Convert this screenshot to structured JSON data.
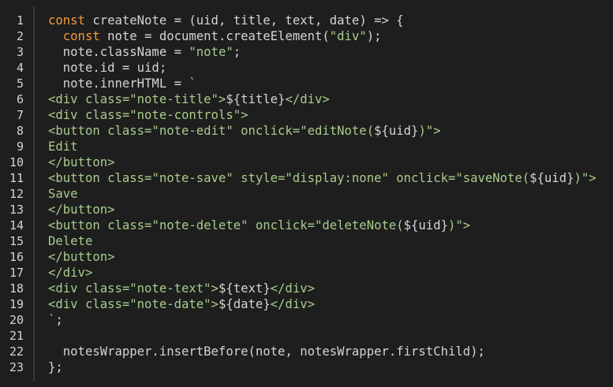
{
  "editor": {
    "colors": {
      "background": "#1e1e1e",
      "text": "#d4d4d4",
      "keyword": "#f29c3a",
      "string": "#a8cc8c",
      "divider": "#3a3a3a"
    },
    "lines": [
      {
        "n": "1",
        "tokens": [
          {
            "t": "key",
            "v": "const"
          },
          {
            "t": "txt",
            "v": " createNote = (uid, title, text, date) => {"
          }
        ]
      },
      {
        "n": "2",
        "tokens": [
          {
            "t": "txt",
            "v": "  "
          },
          {
            "t": "key",
            "v": "const"
          },
          {
            "t": "txt",
            "v": " note = document.createElement("
          },
          {
            "t": "str",
            "v": "\"div\""
          },
          {
            "t": "txt",
            "v": ");"
          }
        ]
      },
      {
        "n": "3",
        "tokens": [
          {
            "t": "txt",
            "v": "  note.className = "
          },
          {
            "t": "str",
            "v": "\"note\""
          },
          {
            "t": "txt",
            "v": ";"
          }
        ]
      },
      {
        "n": "4",
        "tokens": [
          {
            "t": "txt",
            "v": "  note.id = uid;"
          }
        ]
      },
      {
        "n": "5",
        "tokens": [
          {
            "t": "txt",
            "v": "  note.innerHTML = "
          },
          {
            "t": "str",
            "v": "`"
          }
        ]
      },
      {
        "n": "6",
        "tokens": [
          {
            "t": "str",
            "v": "<div class=\"note-title\">"
          },
          {
            "t": "txt",
            "v": "${title}"
          },
          {
            "t": "str",
            "v": "</div>"
          }
        ]
      },
      {
        "n": "7",
        "tokens": [
          {
            "t": "str",
            "v": "<div class=\"note-controls\">"
          }
        ]
      },
      {
        "n": "8",
        "tokens": [
          {
            "t": "str",
            "v": "<button class=\"note-edit\" onclick=\"editNote("
          },
          {
            "t": "txt",
            "v": "${uid}"
          },
          {
            "t": "str",
            "v": ")\">"
          }
        ]
      },
      {
        "n": "9",
        "tokens": [
          {
            "t": "str",
            "v": "Edit"
          }
        ]
      },
      {
        "n": "10",
        "tokens": [
          {
            "t": "str",
            "v": "</button>"
          }
        ]
      },
      {
        "n": "11",
        "tokens": [
          {
            "t": "str",
            "v": "<button class=\"note-save\" style=\"display:none\" onclick=\"saveNote("
          },
          {
            "t": "txt",
            "v": "${uid}"
          },
          {
            "t": "str",
            "v": ")\">"
          }
        ]
      },
      {
        "n": "12",
        "tokens": [
          {
            "t": "str",
            "v": "Save"
          }
        ]
      },
      {
        "n": "13",
        "tokens": [
          {
            "t": "str",
            "v": "</button>"
          }
        ]
      },
      {
        "n": "14",
        "tokens": [
          {
            "t": "str",
            "v": "<button class=\"note-delete\" onclick=\"deleteNote("
          },
          {
            "t": "txt",
            "v": "${uid}"
          },
          {
            "t": "str",
            "v": ")\">"
          }
        ]
      },
      {
        "n": "15",
        "tokens": [
          {
            "t": "str",
            "v": "Delete"
          }
        ]
      },
      {
        "n": "16",
        "tokens": [
          {
            "t": "str",
            "v": "</button>"
          }
        ]
      },
      {
        "n": "17",
        "tokens": [
          {
            "t": "str",
            "v": "</div>"
          }
        ]
      },
      {
        "n": "18",
        "tokens": [
          {
            "t": "str",
            "v": "<div class=\"note-text\">"
          },
          {
            "t": "txt",
            "v": "${text}"
          },
          {
            "t": "str",
            "v": "</div>"
          }
        ]
      },
      {
        "n": "19",
        "tokens": [
          {
            "t": "str",
            "v": "<div class=\"note-date\">"
          },
          {
            "t": "txt",
            "v": "${date}"
          },
          {
            "t": "str",
            "v": "</div>"
          }
        ]
      },
      {
        "n": "20",
        "tokens": [
          {
            "t": "str",
            "v": "`"
          },
          {
            "t": "txt",
            "v": ";"
          }
        ]
      },
      {
        "n": "21",
        "tokens": []
      },
      {
        "n": "22",
        "tokens": [
          {
            "t": "txt",
            "v": "  notesWrapper.insertBefore(note, notesWrapper.firstChild);"
          }
        ]
      },
      {
        "n": "23",
        "tokens": [
          {
            "t": "txt",
            "v": "};"
          }
        ]
      }
    ]
  }
}
